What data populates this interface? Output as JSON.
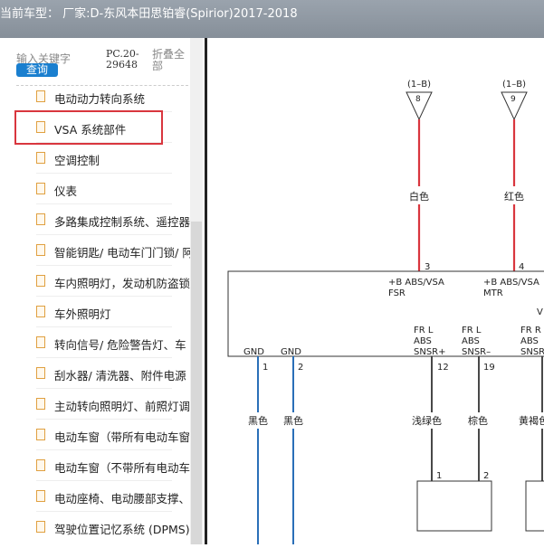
{
  "title": "当前车型： 厂家:D-东风本田思铂睿(Spirior)2017-2018",
  "sidebar": {
    "search_label": "输入关键字",
    "query_button": "查询",
    "pc_code": "PC.20-29648",
    "collapse_all": "折叠全部",
    "items": [
      {
        "label": "电动动力转向系统"
      },
      {
        "label": "VSA 系统部件"
      },
      {
        "label": "空调控制"
      },
      {
        "label": "仪表"
      },
      {
        "label": "多路集成控制系统、遥控器"
      },
      {
        "label": "智能钥匙/ 电动车门门锁/ 阿"
      },
      {
        "label": "车内照明灯，发动机防盗锁"
      },
      {
        "label": "车外照明灯"
      },
      {
        "label": "转向信号/ 危险警告灯、车"
      },
      {
        "label": "刮水器/ 清洗器、附件电源"
      },
      {
        "label": "主动转向照明灯、前照灯调"
      },
      {
        "label": "电动车窗（带所有电动车窗"
      },
      {
        "label": "电动车窗（不带所有电动车"
      },
      {
        "label": "电动座椅、电动腰部支撑、"
      },
      {
        "label": "驾驶位置记忆系统 (DPMS)"
      }
    ],
    "selected_index": 1
  },
  "diagram": {
    "connectors": [
      {
        "ref": "(1–B)",
        "pin": "8"
      },
      {
        "ref": "(1–B)",
        "pin": "9"
      }
    ],
    "wire_colors": {
      "white": "白色",
      "red": "红色",
      "black": "黑色",
      "light_green": "浅绿色",
      "brown": "棕色",
      "yellow_brown": "黄褐色"
    },
    "pins": [
      "3",
      "4",
      "1",
      "2",
      "12",
      "19",
      "1",
      "2"
    ],
    "signals": {
      "fsr": [
        "+B ABS/VSA",
        "FSR"
      ],
      "mtr": [
        "+B ABS/VSA",
        "MTR"
      ],
      "gnd": "GND",
      "v": "V",
      "fr_l_plus": [
        "FR L",
        "ABS",
        "SNSR+"
      ],
      "fr_l_minus": [
        "FR L",
        "ABS",
        "SNSR–"
      ],
      "fr_r": [
        "FR R",
        "ABS",
        "SNSR"
      ]
    },
    "colors": {
      "red_wire": "#d9363e",
      "blue_wire": "#2a6fb8",
      "black_wire": "#333333"
    }
  }
}
